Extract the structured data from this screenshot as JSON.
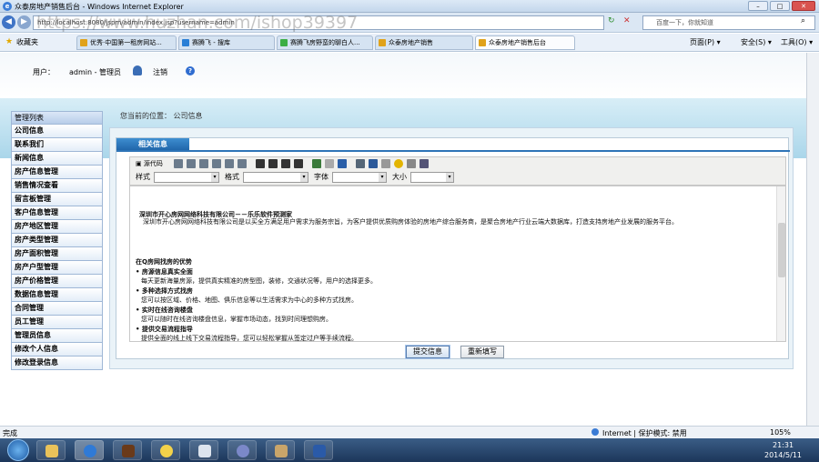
{
  "window": {
    "title": "众泰房地产销售后台 - Windows Internet Explorer"
  },
  "address": {
    "url": "http://localhost:8080/jspm/admin/index.jsp?username=admin",
    "search_placeholder": "百度一下，你就知道"
  },
  "favorites_label": "收藏夹",
  "tabs": [
    {
      "label": "优秀·中国第一租房网站..."
    },
    {
      "label": "赛腾飞 - 搜库"
    },
    {
      "label": "赛腾飞房野蛮的聊白人..."
    },
    {
      "label": "众泰房地产销售"
    },
    {
      "label": "众泰房地产销售后台"
    }
  ],
  "commands": {
    "page": "页面(P) ▾",
    "safety": "安全(S) ▾",
    "tools": "工具(O) ▾",
    "help": "?▾"
  },
  "header": {
    "user_label": "用户：",
    "user_value": "admin - 管理员",
    "logout": "注销",
    "help": "?"
  },
  "sidebar": {
    "title": "管理列表",
    "items": [
      "公司信息",
      "联系我们",
      "新闻信息",
      "房产信息管理",
      "销售情况查看",
      "留言板管理",
      "客户信息管理",
      "房产地区管理",
      "房产类型管理",
      "房产面积管理",
      "房产户型管理",
      "房产价格管理",
      "数据信息管理",
      "合同管理",
      "员工管理",
      "管理员信息",
      "修改个人信息",
      "修改登录信息"
    ]
  },
  "breadcrumb": "您当前的位置： 公司信息",
  "panel": {
    "title": "相关信息"
  },
  "editor": {
    "source_label": "源代码",
    "style_label": "样式",
    "format_label": "格式",
    "font_label": "字体",
    "size_label": "大小",
    "lines": [
      {
        "text": "深圳市开心房网网络科技有限公司－－乐乐软件预测家",
        "bold": true
      },
      {
        "text": "深圳市开心房网网络科技有限公司是以买全方满足用户需求为服务宗旨，为客户提供优质购房体验的房地产综合服务商，是聚合房地产行业云端大数据库，打造支持房地产业发展的服务平台。",
        "bold": false
      },
      {
        "text": "在Q房网找房的优势",
        "bold": true
      },
      {
        "text": "• 房源信息真实全面",
        "bold": true
      },
      {
        "text": "每天更新海量房源，提供真实精准的房型图，装修，交通状况等，用户的选择更多。",
        "bold": false
      },
      {
        "text": "• 多种选择方式找房",
        "bold": true
      },
      {
        "text": "您可以按区域、价格、地图、俱乐信息等以生活需求为中心的多种方式找房。",
        "bold": false
      },
      {
        "text": "• 实时在线咨询楼盘",
        "bold": true
      },
      {
        "text": "您可以随时在线咨询楼盘信息，掌握市场动态，找到时间理想购房。",
        "bold": false
      },
      {
        "text": "• 提供交易流程指导",
        "bold": true
      },
      {
        "text": "提供全面的线上线下交易流程指导，您可以轻松掌握从签定过户等手续流程。",
        "bold": false
      }
    ]
  },
  "buttons": {
    "submit": "提交信息",
    "reset": "重新填写"
  },
  "status": {
    "left": "完成",
    "zone": "Internet | 保护模式: 禁用",
    "zoom": "105%"
  },
  "clock": {
    "time": "21:31",
    "date": "2014/5/11"
  },
  "watermark": "https://www.huzhan.com/ishop39397",
  "colors": {
    "accent": "#2e74b7",
    "band": "#aad6ea"
  }
}
